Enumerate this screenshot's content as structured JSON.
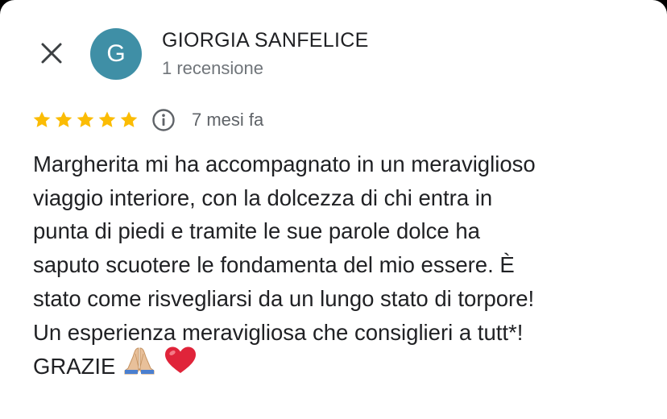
{
  "reviewer": {
    "avatar_letter": "G",
    "avatar_color": "#3f8fa6",
    "name": "GIORGIA SANFELICE",
    "review_count": "1 recensione"
  },
  "review": {
    "rating": 5,
    "rating_max": 5,
    "star_color": "#fbbc04",
    "time_ago": "7 mesi fa",
    "lines": [
      "Margherita mi ha accompagnato in un meraviglioso",
      "viaggio interiore, con la dolcezza di chi entra in",
      "punta di piedi e tramite le sue parole dolce ha",
      "saputo scuotere le fondamenta del mio essere. È",
      "stato come risvegliarsi da un lungo stato di torpore!",
      "Un esperienza meravigliosa che consiglieri a tutt*!",
      "GRAZIE"
    ],
    "trailing_emoji": [
      "folded-hands-emoji",
      "red-heart-emoji"
    ]
  },
  "icons": {
    "close": "close-icon",
    "info": "info-icon",
    "star": "star-icon"
  }
}
